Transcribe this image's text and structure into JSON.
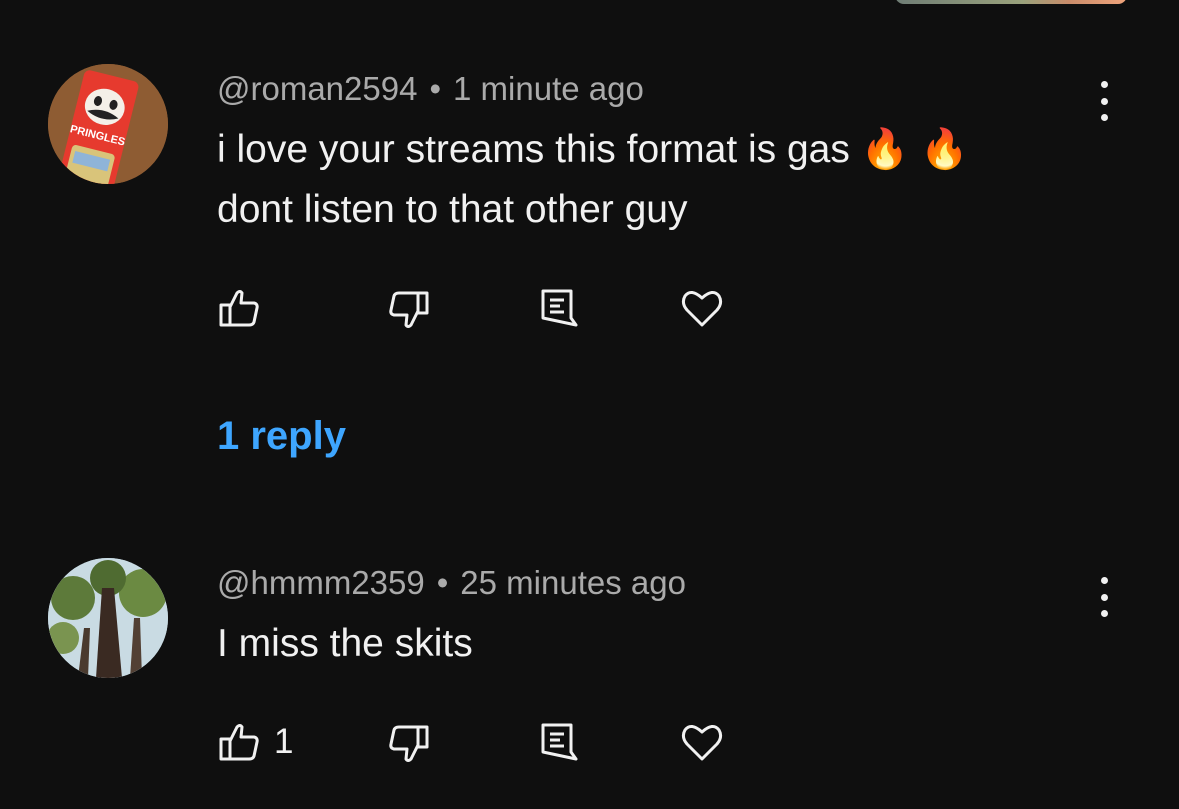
{
  "comments": [
    {
      "handle": "@roman2594",
      "separator": "•",
      "time": "1 minute ago",
      "lines": [
        "i love your streams this format is gas 🔥 🔥",
        "dont listen to that other guy"
      ],
      "like_count": "",
      "avatar_logo_text": "PRINGLES",
      "replies_label": "1 reply"
    },
    {
      "handle": "@hmmm2359",
      "separator": "•",
      "time": "25 minutes ago",
      "lines": [
        "I miss the skits"
      ],
      "like_count": "1"
    }
  ],
  "icons": [
    "thumbs-up-icon",
    "thumbs-down-icon",
    "reply-icon",
    "heart-icon",
    "more-vert-icon"
  ],
  "colors": {
    "background": "#0f0f0f",
    "text": "#f1f1f1",
    "meta": "#aaaaaa",
    "link": "#3ea6ff"
  }
}
